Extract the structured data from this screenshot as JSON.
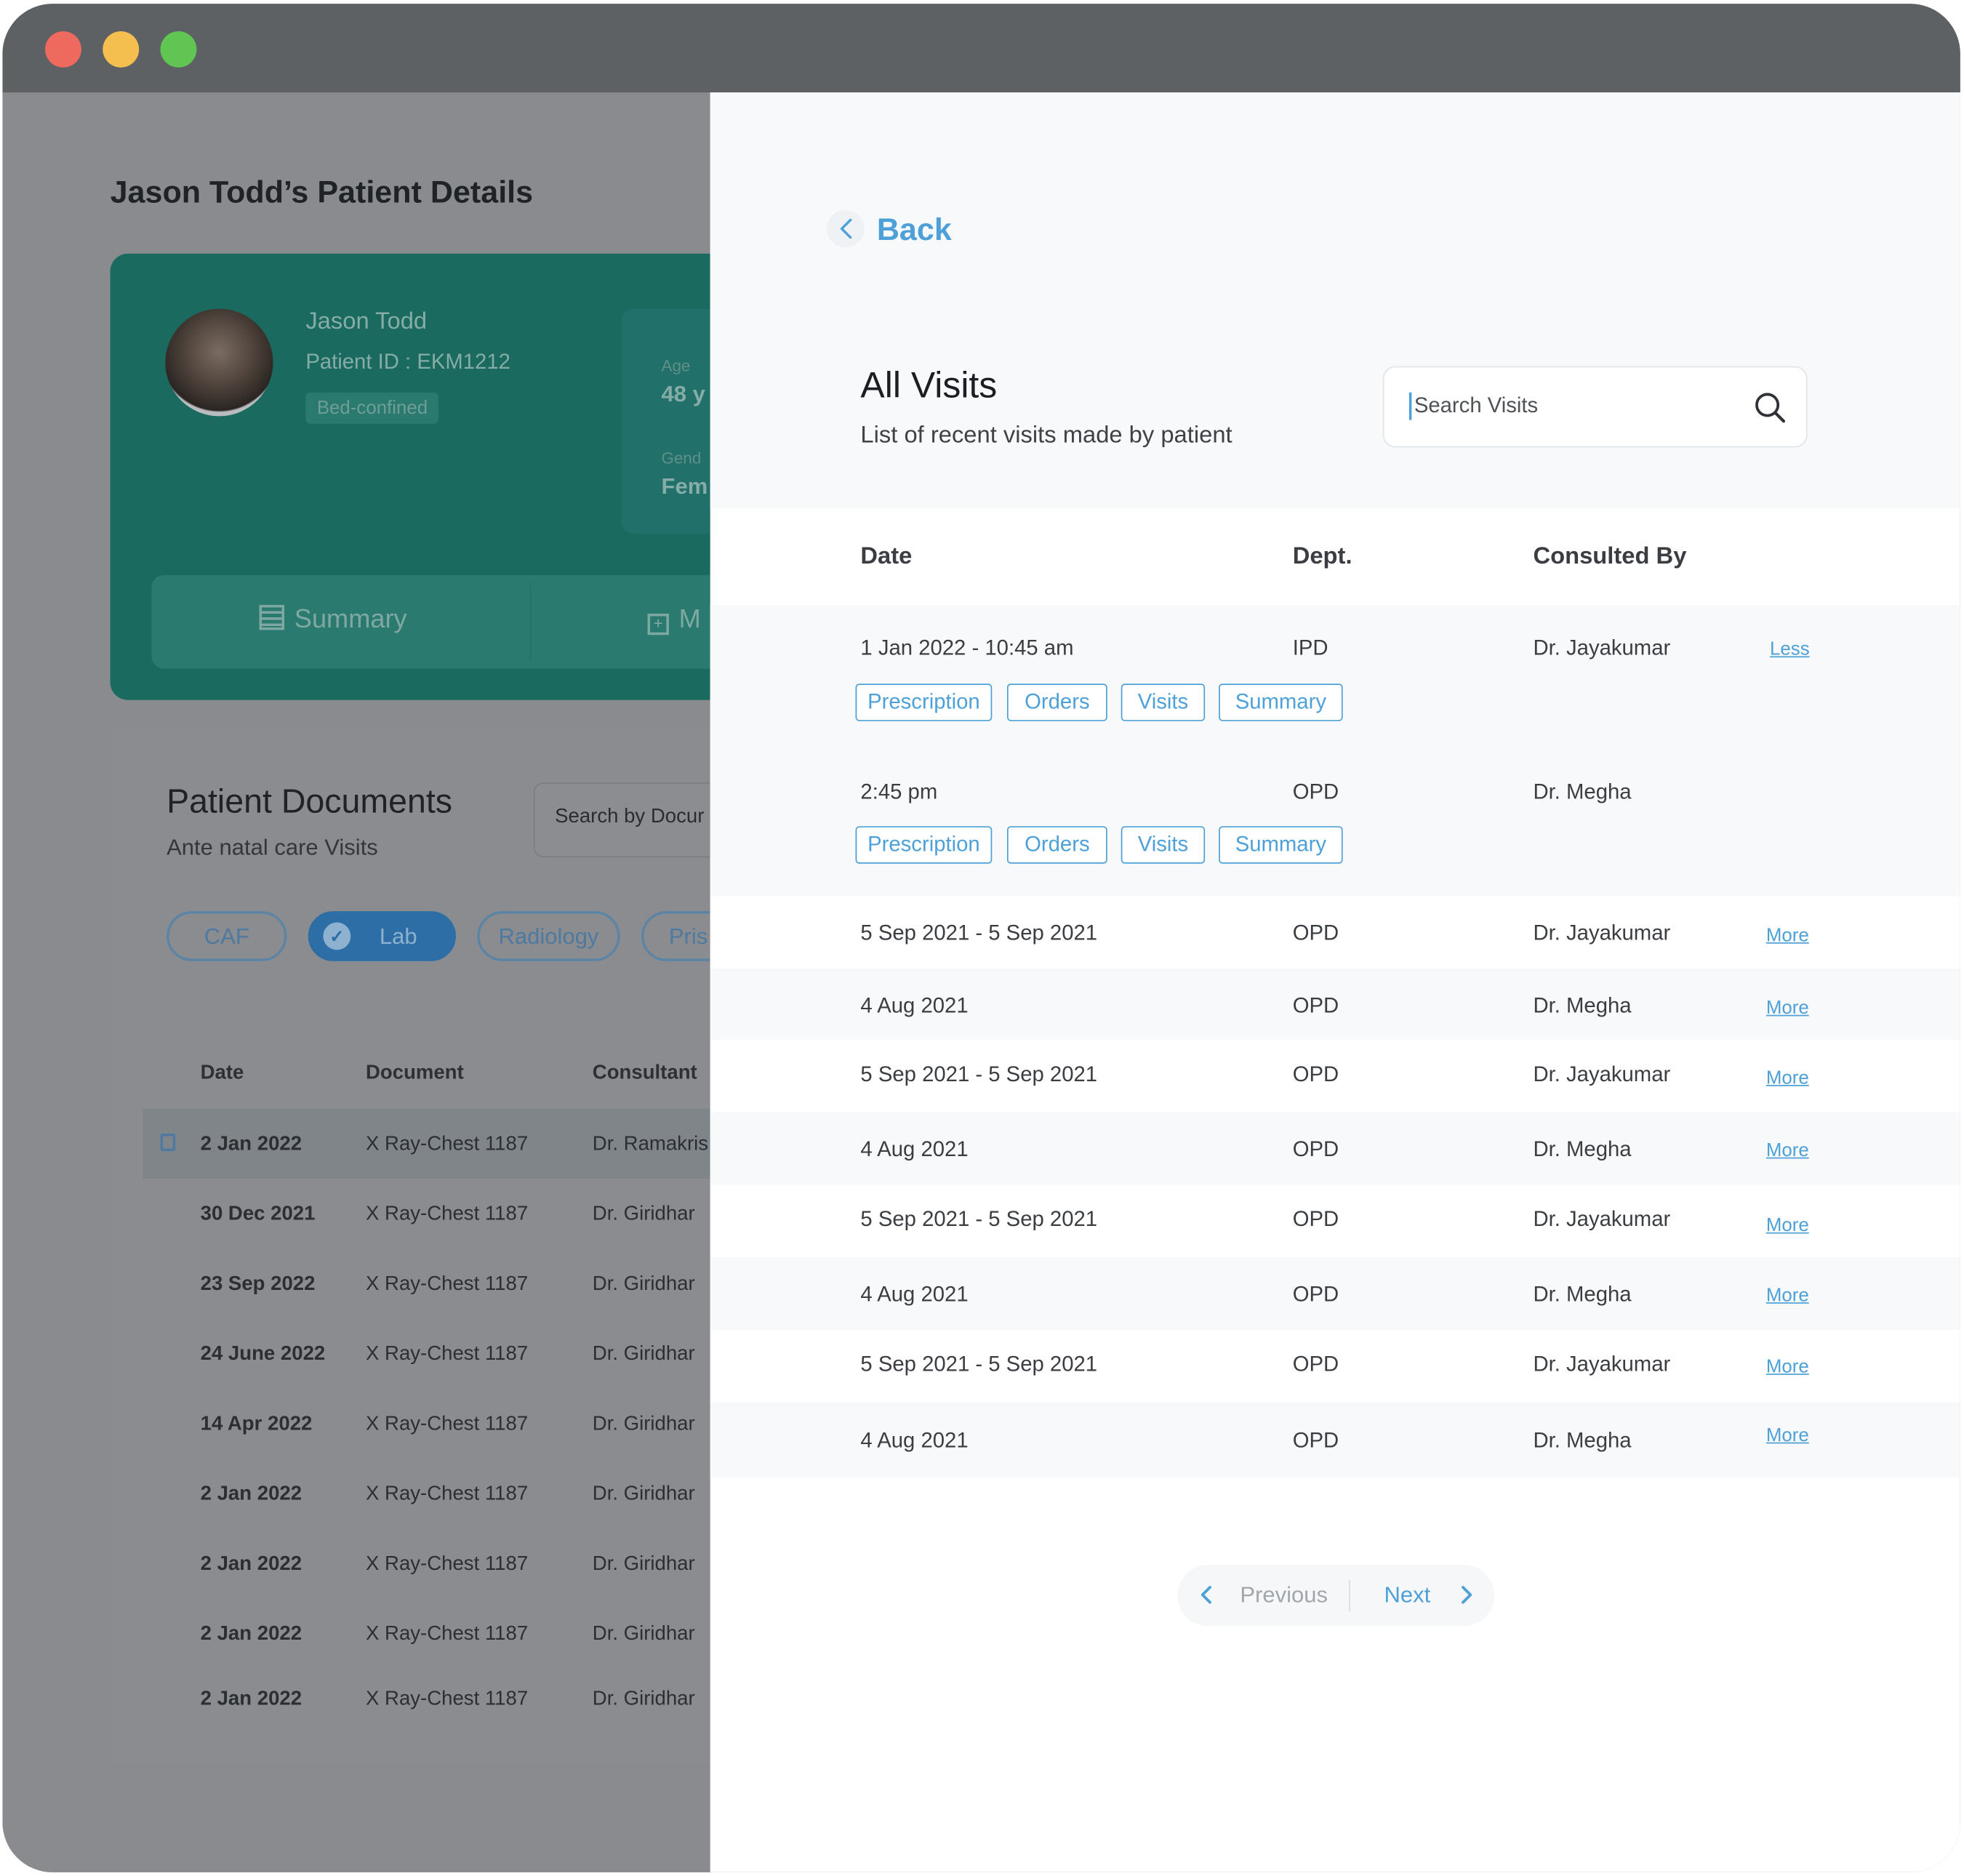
{
  "window": {
    "controls": {
      "close_color": "#ee6a5f",
      "minimize_color": "#f5bf4f",
      "maximize_color": "#61c554"
    }
  },
  "background_page": {
    "title": "Jason Todd’s Patient Details",
    "patient_card": {
      "name": "Jason Todd",
      "patient_id": "Patient ID : EKM1212",
      "status_badge": "Bed-confined",
      "age_label": "Age",
      "age_value": "48 y",
      "gender_label": "Gend",
      "gender_value": "Fem",
      "tabs": [
        {
          "label": "Summary",
          "icon": "list-icon"
        },
        {
          "label": "M",
          "icon": "plus-square-icon"
        }
      ]
    },
    "documents": {
      "title": "Patient Documents",
      "subtitle": "Ante natal care Visits",
      "search_placeholder": "Search by Docur",
      "chips": [
        {
          "label": "CAF",
          "selected": false
        },
        {
          "label": "Lab",
          "selected": true
        },
        {
          "label": "Radiology",
          "selected": false
        },
        {
          "label": "Pris",
          "selected": false
        }
      ],
      "columns": [
        "Date",
        "Document",
        "Consultant"
      ],
      "rows": [
        {
          "date": "2 Jan 2022",
          "document": "X Ray-Chest 1187",
          "consultant": "Dr. Ramakris",
          "selected": true
        },
        {
          "date": "30 Dec 2021",
          "document": "X Ray-Chest 1187",
          "consultant": "Dr. Giridhar",
          "selected": false
        },
        {
          "date": "23 Sep 2022",
          "document": "X Ray-Chest 1187",
          "consultant": "Dr. Giridhar",
          "selected": false
        },
        {
          "date": "24 June 2022",
          "document": "X Ray-Chest 1187",
          "consultant": "Dr. Giridhar",
          "selected": false
        },
        {
          "date": "14 Apr 2022",
          "document": "X Ray-Chest 1187",
          "consultant": "Dr. Giridhar",
          "selected": false
        },
        {
          "date": "2 Jan 2022",
          "document": "X Ray-Chest 1187",
          "consultant": "Dr. Giridhar",
          "selected": false
        },
        {
          "date": "2 Jan 2022",
          "document": "X Ray-Chest 1187",
          "consultant": "Dr. Giridhar",
          "selected": false
        },
        {
          "date": "2 Jan 2022",
          "document": "X Ray-Chest 1187",
          "consultant": "Dr. Giridhar",
          "selected": false
        },
        {
          "date": "2 Jan 2022",
          "document": "X Ray-Chest 1187",
          "consultant": "Dr. Giridhar",
          "selected": false
        }
      ]
    }
  },
  "visits_panel": {
    "back_label": "Back",
    "title": "All Visits",
    "subtitle": "List of recent visits made by patient",
    "search_placeholder": "Search Visits",
    "columns": {
      "date": "Date",
      "dept": "Dept.",
      "consulted_by": "Consulted By"
    },
    "expanded_visit": {
      "toggle_label": "Less",
      "entries": [
        {
          "date": "1 Jan 2022 - 10:45 am",
          "dept": "IPD",
          "doctor": "Dr. Jayakumar",
          "actions": [
            "Prescription",
            "Orders",
            "Visits",
            "Summary"
          ]
        },
        {
          "date": "2:45 pm",
          "dept": "OPD",
          "doctor": "Dr. Megha",
          "actions": [
            "Prescription",
            "Orders",
            "Visits",
            "Summary"
          ]
        }
      ]
    },
    "visits": [
      {
        "date": "5 Sep 2021 - 5 Sep 2021",
        "dept": "OPD",
        "doctor": "Dr. Jayakumar",
        "more": "More"
      },
      {
        "date": "4 Aug 2021",
        "dept": "OPD",
        "doctor": "Dr. Megha",
        "more": "More"
      },
      {
        "date": "5 Sep 2021 - 5 Sep 2021",
        "dept": "OPD",
        "doctor": "Dr. Jayakumar",
        "more": "More"
      },
      {
        "date": "4 Aug 2021",
        "dept": "OPD",
        "doctor": "Dr. Megha",
        "more": "More"
      },
      {
        "date": "5 Sep 2021 - 5 Sep 2021",
        "dept": "OPD",
        "doctor": "Dr. Jayakumar",
        "more": "More"
      },
      {
        "date": "4 Aug 2021",
        "dept": "OPD",
        "doctor": "Dr. Megha",
        "more": "More"
      },
      {
        "date": "5 Sep 2021 - 5 Sep 2021",
        "dept": "OPD",
        "doctor": "Dr. Jayakumar",
        "more": "More"
      },
      {
        "date": "4 Aug 2021",
        "dept": "OPD",
        "doctor": "Dr. Megha",
        "more": "More"
      }
    ],
    "pagination": {
      "previous_label": "Previous",
      "next_label": "Next",
      "previous_enabled": false,
      "next_enabled": true
    }
  },
  "colors": {
    "accent": "#4ea1d8",
    "text": "#3a3e42",
    "row_stripe": "#f8f9fa"
  }
}
